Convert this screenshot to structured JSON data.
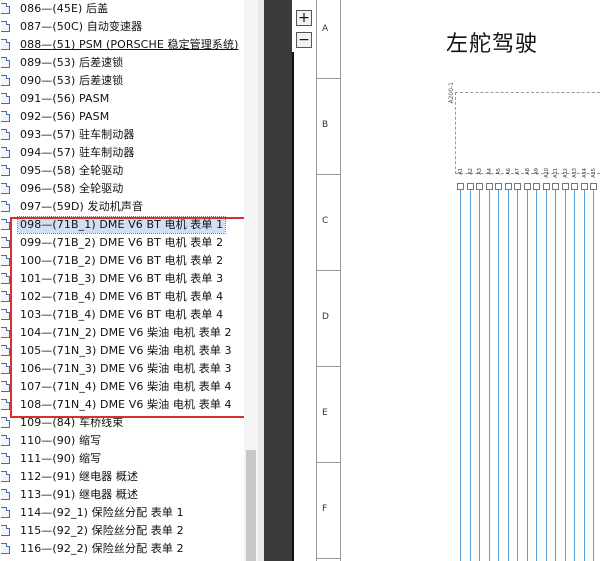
{
  "bookmarks": [
    {
      "label": "086—(45E) 后盖"
    },
    {
      "label": "087—(50C) 自动变速器"
    },
    {
      "label": "088—(51) PSM (PORSCHE 稳定管理系统)"
    },
    {
      "label": "089—(53) 后差速锁"
    },
    {
      "label": "090—(53) 后差速锁"
    },
    {
      "label": "091—(56) PASM"
    },
    {
      "label": "092—(56) PASM"
    },
    {
      "label": "093—(57) 驻车制动器"
    },
    {
      "label": "094—(57) 驻车制动器"
    },
    {
      "label": "095—(58) 全轮驱动"
    },
    {
      "label": "096—(58) 全轮驱动"
    },
    {
      "label": "097—(59D) 发动机声音"
    },
    {
      "label": "098—(71B_1) DME V6 BT 电机 表单 1"
    },
    {
      "label": "099—(71B_2) DME V6 BT 电机 表单 2"
    },
    {
      "label": "100—(71B_2) DME V6 BT 电机 表单 2"
    },
    {
      "label": "101—(71B_3) DME V6 BT 电机 表单 3"
    },
    {
      "label": "102—(71B_4) DME V6 BT 电机 表单 4"
    },
    {
      "label": "103—(71B_4) DME V6 BT 电机 表单 4"
    },
    {
      "label": "104—(71N_2) DME V6 柴油 电机 表单 2"
    },
    {
      "label": "105—(71N_3) DME V6 柴油 电机 表单 3"
    },
    {
      "label": "106—(71N_3) DME V6 柴油 电机 表单 3"
    },
    {
      "label": "107—(71N_4) DME V6 柴油 电机 表单 4"
    },
    {
      "label": "108—(71N_4) DME V6 柴油 电机 表单 4"
    },
    {
      "label": "109—(84) 车桥线束"
    },
    {
      "label": "110—(90) 缩写"
    },
    {
      "label": "111—(90) 缩写"
    },
    {
      "label": "112—(91) 继电器 概述"
    },
    {
      "label": "113—(91) 继电器 概述"
    },
    {
      "label": "114—(92_1) 保险丝分配 表单 1"
    },
    {
      "label": "115—(92_2) 保险丝分配 表单 2"
    },
    {
      "label": "116—(92_2) 保险丝分配 表单 2"
    }
  ],
  "selected_bookmark": "098—(71B_1) DME V6 BT 电机 表单 1",
  "zoom": {
    "plus": "+",
    "minus": "−"
  },
  "page": {
    "title": "左舵驾驶",
    "ruler_letters": [
      "A",
      "B",
      "C",
      "D",
      "E",
      "F"
    ],
    "connector_label": "A200-1",
    "pins": [
      "A1",
      "A2",
      "A3",
      "A4",
      "A5",
      "A6",
      "A7",
      "A8",
      "A9",
      "A10",
      "A11",
      "A12",
      "A13",
      "A14",
      "A15"
    ]
  },
  "colors": {
    "highlight": "#d9302d",
    "selection": "#cfe0f5",
    "wire": "#5aa0d8"
  }
}
